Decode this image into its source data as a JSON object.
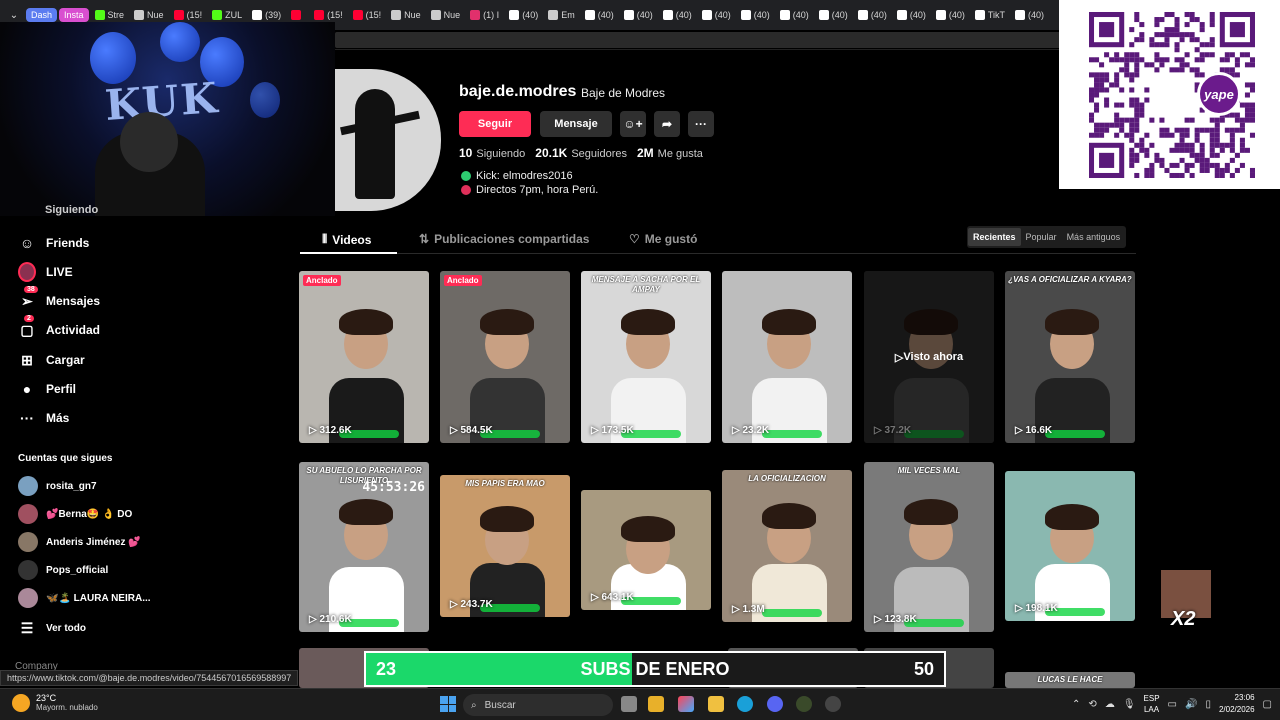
{
  "browser": {
    "tabs": [
      {
        "label": "Dash",
        "color": "#5b7cf0",
        "pill": true
      },
      {
        "label": "Insta",
        "color": "#d94fd0",
        "pill": true
      },
      {
        "label": "Stre",
        "color": "#53fc18"
      },
      {
        "label": "Nue",
        "color": "#cccccc"
      },
      {
        "label": "(15!",
        "color": "#ff0033"
      },
      {
        "label": "ZUL",
        "color": "#53fc18"
      },
      {
        "label": "(39)",
        "color": "#ffffff"
      },
      {
        "label": "",
        "color": "#ff0033"
      },
      {
        "label": "(15!",
        "color": "#ff0033"
      },
      {
        "label": "(15!",
        "color": "#ff0033"
      },
      {
        "label": "Nue",
        "color": "#cccccc"
      },
      {
        "label": "Nue",
        "color": "#cccccc"
      },
      {
        "label": "(1) I",
        "color": "#e1306c"
      },
      {
        "label": "(40)",
        "color": "#ffffff"
      },
      {
        "label": "Em",
        "color": "#cccccc"
      },
      {
        "label": "(40)",
        "color": "#ffffff"
      },
      {
        "label": "(40)",
        "color": "#ffffff"
      },
      {
        "label": "(40)",
        "color": "#ffffff"
      },
      {
        "label": "(40)",
        "color": "#ffffff"
      },
      {
        "label": "(40)",
        "color": "#ffffff"
      },
      {
        "label": "(40)",
        "color": "#ffffff"
      },
      {
        "label": "(40)",
        "color": "#ffffff"
      },
      {
        "label": "(40)",
        "color": "#ffffff"
      },
      {
        "label": "(40)",
        "color": "#ffffff"
      },
      {
        "label": "(40)",
        "color": "#ffffff"
      },
      {
        "label": "TikT",
        "color": "#ffffff"
      },
      {
        "label": "(40)",
        "color": "#ffffff"
      }
    ]
  },
  "webcam": {
    "sign_text": "KUK"
  },
  "qr": {
    "brand": "yape"
  },
  "sidebar": {
    "partial_top": "Siguiendo",
    "items": [
      {
        "label": "Friends",
        "icon": "friends-icon",
        "glyph": "☺",
        "badge": ""
      },
      {
        "label": "LIVE",
        "icon": "live-icon",
        "glyph": "",
        "badge": ""
      },
      {
        "label": "Mensajes",
        "icon": "inbox-icon",
        "glyph": "➢",
        "badge": "38"
      },
      {
        "label": "Actividad",
        "icon": "activity-icon",
        "glyph": "▢",
        "badge": "2"
      },
      {
        "label": "Cargar",
        "icon": "upload-icon",
        "glyph": "⊞",
        "badge": ""
      },
      {
        "label": "Perfil",
        "icon": "profile-icon",
        "glyph": "●",
        "badge": ""
      },
      {
        "label": "Más",
        "icon": "more-icon",
        "glyph": "···",
        "badge": ""
      }
    ],
    "following_heading": "Cuentas que sigues",
    "following": [
      {
        "name": "rosita_gn7",
        "color": "#7aa0c0"
      },
      {
        "name": "💕Berna🤩 👌 DO",
        "color": "#a05060"
      },
      {
        "name": "Anderis Jiménez 💕",
        "color": "#887766"
      },
      {
        "name": "Pops_official",
        "color": "#333333"
      },
      {
        "name": "🦋🏝️ LAURA NEIRA...",
        "color": "#aa8899"
      }
    ],
    "see_all": "Ver todo",
    "company": "Company"
  },
  "profile": {
    "username": "baje.de.modres",
    "display_name": "Baje de Modres",
    "follow_label": "Seguir",
    "message_label": "Mensaje",
    "stats": [
      {
        "num": "10",
        "label": "Siguiendo"
      },
      {
        "num": "20.1K",
        "label": "Seguidores"
      },
      {
        "num": "2M",
        "label": "Me gusta"
      }
    ],
    "bio": [
      {
        "text": "Kick: elmodres2016",
        "color": "#2ecc71"
      },
      {
        "text": "Directos 7pm, hora Perú.",
        "color": "#e0305a"
      }
    ]
  },
  "tabs": {
    "videos": "Videos",
    "reposts": "Publicaciones compartidas",
    "liked": "Me gustó",
    "sort": [
      "Recientes",
      "Popular",
      "Más antiguos"
    ]
  },
  "videos": [
    {
      "views": "312.6K",
      "pinned": "Anclado",
      "caption": "",
      "bg": "#b9b6b0",
      "shirt": "#1a1a1a"
    },
    {
      "views": "584.5K",
      "pinned": "Anclado",
      "caption": "",
      "bg": "#6e6a66",
      "shirt": "#333333"
    },
    {
      "views": "173.5K",
      "pinned": "",
      "caption": "MENSAJE A SACHA POR EL AMPAY",
      "bg": "#d8d8d8",
      "shirt": "#f2f2f2"
    },
    {
      "views": "23.2K",
      "pinned": "",
      "caption": "",
      "bg": "#bdbdbd",
      "shirt": "#f2f2f2"
    },
    {
      "views": "37.2K",
      "pinned": "",
      "caption": "",
      "bg": "#333333",
      "shirt": "#555555",
      "watched": "Visto ahora"
    },
    {
      "views": "16.6K",
      "pinned": "",
      "caption": "¿VAS A OFICIALIZAR A KYARA?",
      "bg": "#4a4a4a",
      "shirt": "#222222"
    },
    {
      "views": "210.6K",
      "pinned": "",
      "caption": "SU ABUELO LO PARCHA POR LISURIENTO",
      "bg": "#9a9a9a",
      "shirt": "#ffffff",
      "timer": "45:53:26"
    },
    {
      "views": "243.7K",
      "pinned": "",
      "caption": "MIS PAPIS ERA MAO",
      "bg": "#c89a6a",
      "shirt": "#222222"
    },
    {
      "views": "643.1K",
      "pinned": "",
      "caption": "",
      "bg": "#a89a80",
      "shirt": "#ffffff"
    },
    {
      "views": "1.3M",
      "pinned": "",
      "caption": "LA OFICIALIZACION",
      "bg": "#9a8a7a",
      "shirt": "#f0e8d8"
    },
    {
      "views": "123.8K",
      "pinned": "",
      "caption": "MIL VECES MAL",
      "bg": "#7a7a7a",
      "shirt": "#bbbbbb"
    },
    {
      "views": "198.1K",
      "pinned": "",
      "caption": "",
      "bg": "#8ab8b0",
      "shirt": "#ffffff"
    }
  ],
  "bottom_row_caption": "LUCAS LE HACE",
  "subs_goal": {
    "current": "23",
    "label": "SUBS DE ENERO",
    "target": "50",
    "progress": 0.46
  },
  "emote_text": "X2",
  "status_url": "https://www.tiktok.com/@baje.de.modres/video/7544567016569588997",
  "taskbar": {
    "temp": "23°C",
    "weather": "Mayorm. nublado",
    "search_placeholder": "Buscar",
    "lang1": "ESP",
    "lang2": "LAA",
    "time": "23:06",
    "date": "2/02/2026"
  }
}
